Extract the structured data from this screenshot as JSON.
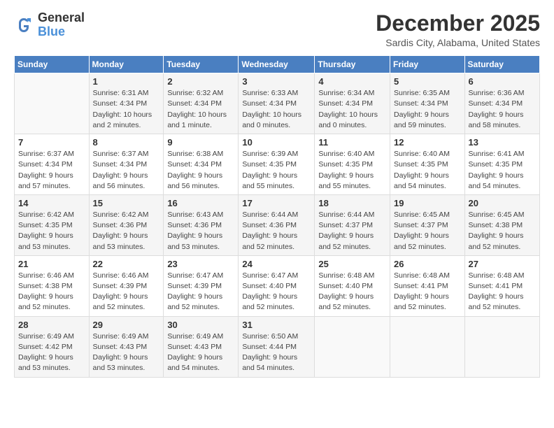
{
  "header": {
    "logo_general": "General",
    "logo_blue": "Blue",
    "month_title": "December 2025",
    "subtitle": "Sardis City, Alabama, United States"
  },
  "days_of_week": [
    "Sunday",
    "Monday",
    "Tuesday",
    "Wednesday",
    "Thursday",
    "Friday",
    "Saturday"
  ],
  "weeks": [
    [
      {
        "day": "",
        "info": ""
      },
      {
        "day": "1",
        "info": "Sunrise: 6:31 AM\nSunset: 4:34 PM\nDaylight: 10 hours\nand 2 minutes."
      },
      {
        "day": "2",
        "info": "Sunrise: 6:32 AM\nSunset: 4:34 PM\nDaylight: 10 hours\nand 1 minute."
      },
      {
        "day": "3",
        "info": "Sunrise: 6:33 AM\nSunset: 4:34 PM\nDaylight: 10 hours\nand 0 minutes."
      },
      {
        "day": "4",
        "info": "Sunrise: 6:34 AM\nSunset: 4:34 PM\nDaylight: 10 hours\nand 0 minutes."
      },
      {
        "day": "5",
        "info": "Sunrise: 6:35 AM\nSunset: 4:34 PM\nDaylight: 9 hours\nand 59 minutes."
      },
      {
        "day": "6",
        "info": "Sunrise: 6:36 AM\nSunset: 4:34 PM\nDaylight: 9 hours\nand 58 minutes."
      }
    ],
    [
      {
        "day": "7",
        "info": "Sunrise: 6:37 AM\nSunset: 4:34 PM\nDaylight: 9 hours\nand 57 minutes."
      },
      {
        "day": "8",
        "info": "Sunrise: 6:37 AM\nSunset: 4:34 PM\nDaylight: 9 hours\nand 56 minutes."
      },
      {
        "day": "9",
        "info": "Sunrise: 6:38 AM\nSunset: 4:34 PM\nDaylight: 9 hours\nand 56 minutes."
      },
      {
        "day": "10",
        "info": "Sunrise: 6:39 AM\nSunset: 4:35 PM\nDaylight: 9 hours\nand 55 minutes."
      },
      {
        "day": "11",
        "info": "Sunrise: 6:40 AM\nSunset: 4:35 PM\nDaylight: 9 hours\nand 55 minutes."
      },
      {
        "day": "12",
        "info": "Sunrise: 6:40 AM\nSunset: 4:35 PM\nDaylight: 9 hours\nand 54 minutes."
      },
      {
        "day": "13",
        "info": "Sunrise: 6:41 AM\nSunset: 4:35 PM\nDaylight: 9 hours\nand 54 minutes."
      }
    ],
    [
      {
        "day": "14",
        "info": "Sunrise: 6:42 AM\nSunset: 4:35 PM\nDaylight: 9 hours\nand 53 minutes."
      },
      {
        "day": "15",
        "info": "Sunrise: 6:42 AM\nSunset: 4:36 PM\nDaylight: 9 hours\nand 53 minutes."
      },
      {
        "day": "16",
        "info": "Sunrise: 6:43 AM\nSunset: 4:36 PM\nDaylight: 9 hours\nand 53 minutes."
      },
      {
        "day": "17",
        "info": "Sunrise: 6:44 AM\nSunset: 4:36 PM\nDaylight: 9 hours\nand 52 minutes."
      },
      {
        "day": "18",
        "info": "Sunrise: 6:44 AM\nSunset: 4:37 PM\nDaylight: 9 hours\nand 52 minutes."
      },
      {
        "day": "19",
        "info": "Sunrise: 6:45 AM\nSunset: 4:37 PM\nDaylight: 9 hours\nand 52 minutes."
      },
      {
        "day": "20",
        "info": "Sunrise: 6:45 AM\nSunset: 4:38 PM\nDaylight: 9 hours\nand 52 minutes."
      }
    ],
    [
      {
        "day": "21",
        "info": "Sunrise: 6:46 AM\nSunset: 4:38 PM\nDaylight: 9 hours\nand 52 minutes."
      },
      {
        "day": "22",
        "info": "Sunrise: 6:46 AM\nSunset: 4:39 PM\nDaylight: 9 hours\nand 52 minutes."
      },
      {
        "day": "23",
        "info": "Sunrise: 6:47 AM\nSunset: 4:39 PM\nDaylight: 9 hours\nand 52 minutes."
      },
      {
        "day": "24",
        "info": "Sunrise: 6:47 AM\nSunset: 4:40 PM\nDaylight: 9 hours\nand 52 minutes."
      },
      {
        "day": "25",
        "info": "Sunrise: 6:48 AM\nSunset: 4:40 PM\nDaylight: 9 hours\nand 52 minutes."
      },
      {
        "day": "26",
        "info": "Sunrise: 6:48 AM\nSunset: 4:41 PM\nDaylight: 9 hours\nand 52 minutes."
      },
      {
        "day": "27",
        "info": "Sunrise: 6:48 AM\nSunset: 4:41 PM\nDaylight: 9 hours\nand 52 minutes."
      }
    ],
    [
      {
        "day": "28",
        "info": "Sunrise: 6:49 AM\nSunset: 4:42 PM\nDaylight: 9 hours\nand 53 minutes."
      },
      {
        "day": "29",
        "info": "Sunrise: 6:49 AM\nSunset: 4:43 PM\nDaylight: 9 hours\nand 53 minutes."
      },
      {
        "day": "30",
        "info": "Sunrise: 6:49 AM\nSunset: 4:43 PM\nDaylight: 9 hours\nand 54 minutes."
      },
      {
        "day": "31",
        "info": "Sunrise: 6:50 AM\nSunset: 4:44 PM\nDaylight: 9 hours\nand 54 minutes."
      },
      {
        "day": "",
        "info": ""
      },
      {
        "day": "",
        "info": ""
      },
      {
        "day": "",
        "info": ""
      }
    ]
  ]
}
